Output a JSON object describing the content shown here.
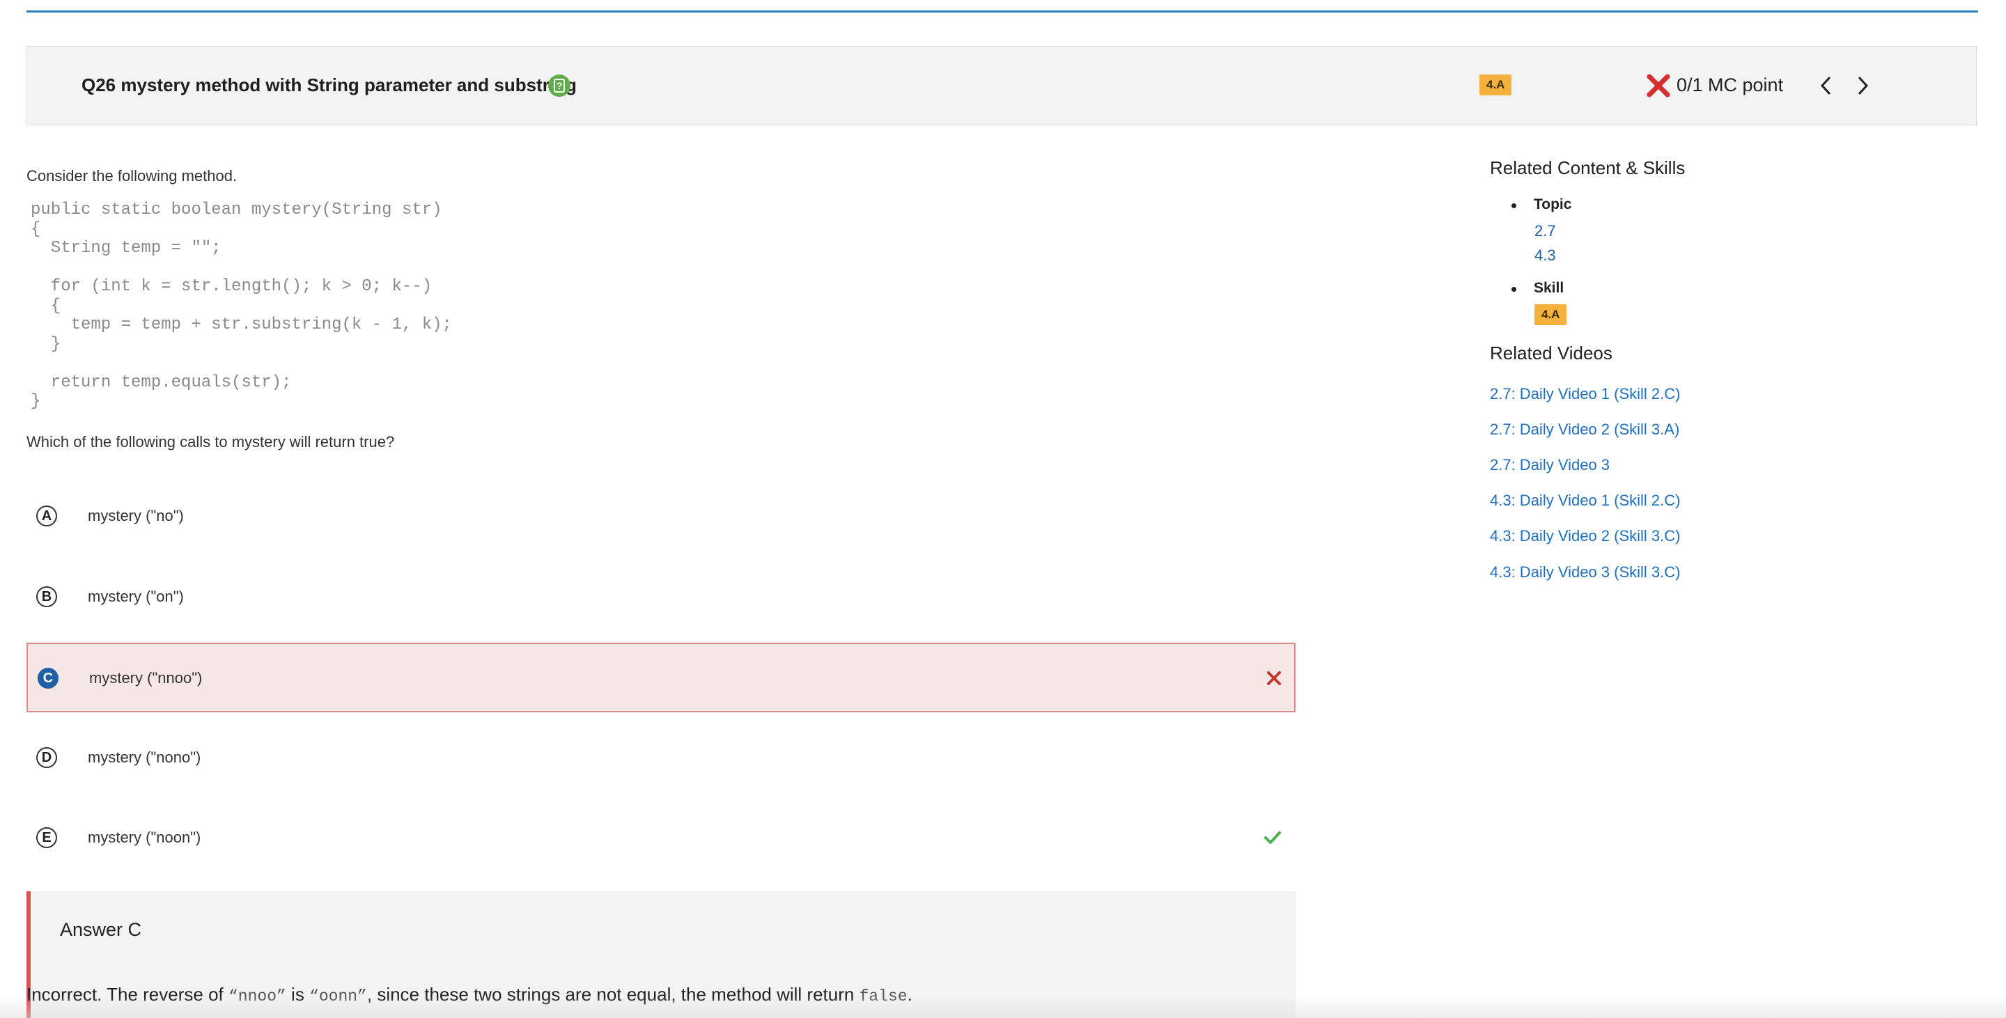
{
  "header": {
    "question_title": "Q26 mystery method with String parameter and substring",
    "skill_badge": "4.A",
    "score": "0/1 MC point"
  },
  "question": {
    "intro": "Consider the following method.",
    "code": "public static boolean mystery(String str)\n{\n  String temp = \"\";\n\n  for (int k = str.length(); k > 0; k--)\n  {\n    temp = temp + str.substring(k - 1, k);\n  }\n\n  return temp.equals(str);\n}",
    "prompt": "Which of the following calls to mystery will return true?"
  },
  "options": [
    {
      "letter": "A",
      "text": "mystery (\"no\")"
    },
    {
      "letter": "B",
      "text": "mystery (\"on\")"
    },
    {
      "letter": "C",
      "text": "mystery (\"nnoo\")"
    },
    {
      "letter": "D",
      "text": "mystery (\"nono\")"
    },
    {
      "letter": "E",
      "text": "mystery (\"noon\")"
    }
  ],
  "selected_option": "C",
  "correct_option": "E",
  "answer": {
    "title": "Answer C",
    "explanation": {
      "part1": "Incorrect. The reverse of ",
      "code1": "“nnoo”",
      "part2": " is ",
      "code2": "“oonn”",
      "part3": ", since these two strings are not equal, the method will return ",
      "code3": "false",
      "part4": "."
    }
  },
  "sidebar": {
    "related_title": "Related Content & Skills",
    "topic_label": "Topic",
    "topics": [
      "2.7",
      "4.3"
    ],
    "skill_label": "Skill",
    "skill_badge": "4.A",
    "videos_title": "Related Videos",
    "videos": [
      "2.7: Daily Video 1 (Skill 2.C)",
      "2.7: Daily Video 2 (Skill 3.A)",
      "2.7: Daily Video 3",
      "4.3: Daily Video 1 (Skill 2.C)",
      "4.3: Daily Video 2 (Skill 3.C)",
      "4.3: Daily Video 3 (Skill 3.C)"
    ]
  },
  "colors": {
    "accent_blue": "#2e7fbf",
    "badge_orange": "#f4b13c",
    "wrong_red": "#d32f2f",
    "correct_green": "#4caf50",
    "selected_bg": "#f7e6e6"
  },
  "icons": {
    "help": "help-icon",
    "score_wrong": "x-icon",
    "prev": "chevron-left-icon",
    "next": "chevron-right-icon",
    "wrong_mark": "x-icon",
    "correct_mark": "check-icon"
  }
}
